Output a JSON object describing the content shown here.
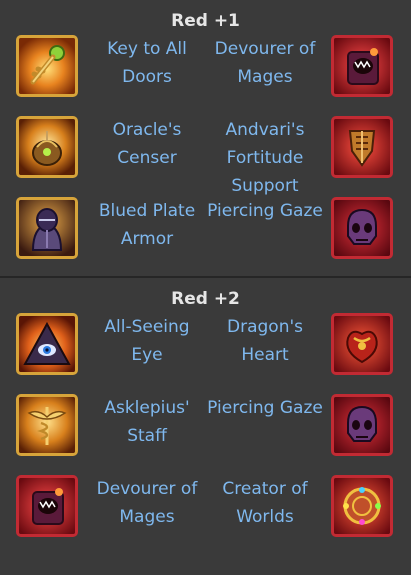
{
  "sections": [
    {
      "title": "Red +1",
      "rows": [
        {
          "left": {
            "name": "Key to All Doors",
            "icon": "key-icon"
          },
          "right": {
            "name": "Devourer of Mages",
            "icon": "devourer-icon"
          }
        },
        {
          "left": {
            "name": "Oracle's Censer",
            "icon": "censer-icon"
          },
          "right": {
            "name": "Andvari's Fortitude Support",
            "icon": "shield-icon"
          }
        },
        {
          "left": {
            "name": "Blued Plate Armor",
            "icon": "armor-icon"
          },
          "right": {
            "name": "Piercing Gaze",
            "icon": "skull-icon"
          }
        }
      ]
    },
    {
      "title": "Red +2",
      "rows": [
        {
          "left": {
            "name": "All-Seeing Eye",
            "icon": "eye-pyramid-icon"
          },
          "right": {
            "name": "Dragon's Heart",
            "icon": "dragon-heart-icon"
          }
        },
        {
          "left": {
            "name": "Asklepius' Staff",
            "icon": "caduceus-icon"
          },
          "right": {
            "name": "Piercing Gaze",
            "icon": "skull-icon"
          }
        },
        {
          "left": {
            "name": "Devourer of Mages",
            "icon": "devourer-icon"
          },
          "right": {
            "name": "Creator of Worlds",
            "icon": "orb-icon"
          }
        }
      ]
    }
  ],
  "colors": {
    "background": "#3a3a3a",
    "label": "#7fb8ee",
    "title": "#e6e6e6",
    "gold_frame": "#d7a43a",
    "red_frame": "#c22a33"
  }
}
